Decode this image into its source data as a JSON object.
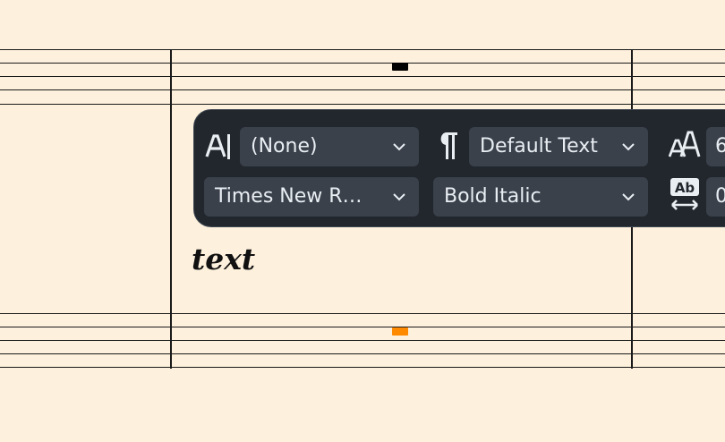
{
  "text_toolbar": {
    "style_icon": "text-style-icon",
    "style_value": "(None)",
    "paragraph_icon": "paragraph-icon",
    "paragraph_value": "Default Text",
    "font_size_icon": "font-size-icon",
    "font_size_value": "6",
    "font_family_value": "Times New R…",
    "font_style_value": "Bold Italic",
    "letter_spacing_icon": "letter-spacing-icon",
    "letter_spacing_value": "0"
  },
  "score": {
    "text_object": "text"
  },
  "colors": {
    "background": "#fdf0dc",
    "toolbar": "#22272d",
    "dropdown": "#3a414b",
    "selection": "#ff8a00"
  }
}
